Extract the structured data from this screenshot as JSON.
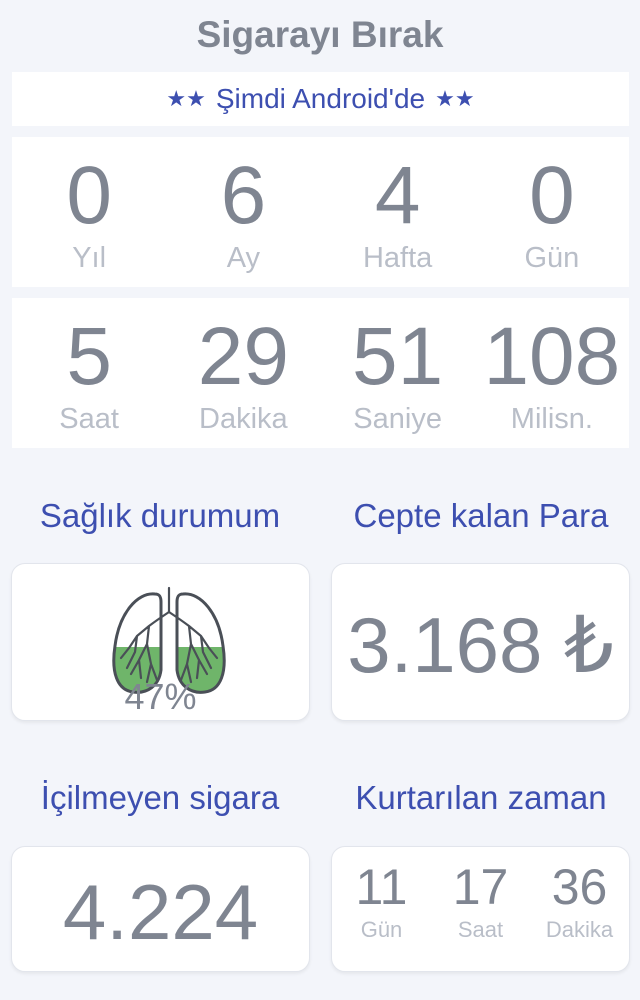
{
  "app": {
    "title": "Sigarayı Bırak"
  },
  "banner": {
    "star": "★★",
    "text": "Şimdi Android'de"
  },
  "quit_time_top": [
    {
      "value": "0",
      "unit": "Yıl"
    },
    {
      "value": "6",
      "unit": "Ay"
    },
    {
      "value": "4",
      "unit": "Hafta"
    },
    {
      "value": "0",
      "unit": "Gün"
    }
  ],
  "quit_time_bottom": [
    {
      "value": "5",
      "unit": "Saat"
    },
    {
      "value": "29",
      "unit": "Dakika"
    },
    {
      "value": "51",
      "unit": "Saniye"
    },
    {
      "value": "108",
      "unit": "Milisn."
    }
  ],
  "health": {
    "label": "Sağlık durumum",
    "percent_text": "47%",
    "percent": 47,
    "icon": "lungs-icon",
    "fill_color": "#6fb56a"
  },
  "money": {
    "label": "Cepte kalan Para",
    "value": "3.168 ₺"
  },
  "cigarettes": {
    "label": "İçilmeyen sigara",
    "value": "4.224"
  },
  "time_saved": {
    "label": "Kurtarılan zaman",
    "items": [
      {
        "value": "11",
        "unit": "Gün"
      },
      {
        "value": "17",
        "unit": "Saat"
      },
      {
        "value": "36",
        "unit": "Dakika"
      }
    ]
  },
  "colors": {
    "accent": "#3d4fb0",
    "text": "#7f8591",
    "muted": "#b9bec8",
    "background": "#f3f5fa"
  }
}
